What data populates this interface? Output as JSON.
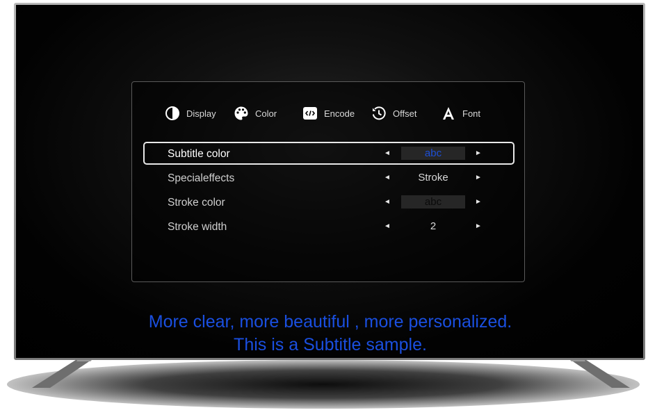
{
  "tabs": [
    {
      "label": "Display",
      "icon": "half-circle-contrast-icon"
    },
    {
      "label": "Color",
      "icon": "palette-icon"
    },
    {
      "label": "Encode",
      "icon": "code-brackets-icon"
    },
    {
      "label": "Offset",
      "icon": "clock-rewind-icon"
    },
    {
      "label": "Font",
      "icon": "letter-a-icon"
    }
  ],
  "settings": [
    {
      "label": "Subtitle color",
      "value": "abc",
      "selected": true
    },
    {
      "label": "Specialeffects",
      "value": "Stroke"
    },
    {
      "label": "Stroke color",
      "value": "abc"
    },
    {
      "label": "Stroke width",
      "value": "2"
    }
  ],
  "arrows": {
    "left": "◄",
    "right": "►"
  },
  "subtitle": {
    "line1": "More clear, more beautiful , more personalized.",
    "line2": "This is a Subtitle sample."
  },
  "colors": {
    "subtitle_text": "#1a4fe0",
    "subtitle_color_sample": "#1d4fd6",
    "stroke_color_sample": "#0a0a0a",
    "selection_border": "#e8e8e8"
  }
}
